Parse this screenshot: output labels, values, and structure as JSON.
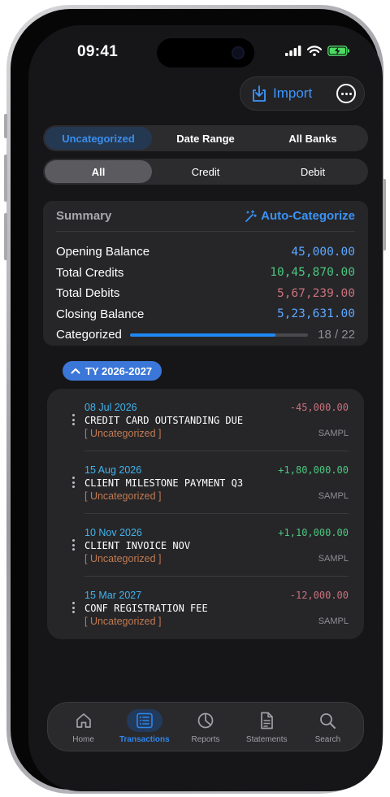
{
  "status_bar": {
    "time": "09:41"
  },
  "top_actions": {
    "import_label": "Import"
  },
  "filter_tabs": [
    {
      "label": "Uncategorized",
      "active": true
    },
    {
      "label": "Date Range",
      "active": false
    },
    {
      "label": "All Banks",
      "active": false
    }
  ],
  "type_tabs": [
    {
      "label": "All",
      "active": true
    },
    {
      "label": "Credit",
      "active": false
    },
    {
      "label": "Debit",
      "active": false
    }
  ],
  "summary": {
    "title": "Summary",
    "auto_categorize_label": "Auto-Categorize",
    "rows": [
      {
        "label": "Opening Balance",
        "value": "45,000.00",
        "color": "#5ca8ff"
      },
      {
        "label": "Total Credits",
        "value": "10,45,870.00",
        "color": "#4cc67d"
      },
      {
        "label": "Total Debits",
        "value": "5,67,239.00",
        "color": "#c9717b"
      },
      {
        "label": "Closing Balance",
        "value": "5,23,631.00",
        "color": "#5ca8ff"
      }
    ],
    "categorized_label": "Categorized",
    "categorized_count": "18 / 22",
    "categorized_fraction": 0.818
  },
  "year_group": {
    "label": "TY 2026-2027",
    "expanded": true
  },
  "transactions": [
    {
      "date": "08 Jul 2026",
      "description": "CREDIT CARD OUTSTANDING DUE",
      "category": "[ Uncategorized ]",
      "amount": "-45,000.00",
      "source": "SAMPL"
    },
    {
      "date": "15 Aug 2026",
      "description": "CLIENT MILESTONE PAYMENT Q3",
      "category": "[ Uncategorized ]",
      "amount": "+1,80,000.00",
      "source": "SAMPL"
    },
    {
      "date": "10 Nov 2026",
      "description": "CLIENT INVOICE NOV",
      "category": "[ Uncategorized ]",
      "amount": "+1,10,000.00",
      "source": "SAMPL"
    },
    {
      "date": "15 Mar 2027",
      "description": "CONF REGISTRATION FEE",
      "category": "[ Uncategorized ]",
      "amount": "-12,000.00",
      "source": "SAMPL"
    }
  ],
  "colors": {
    "credit": "#4cc67d",
    "debit": "#c9717b",
    "accent": "#2f86ea"
  },
  "tab_bar": [
    {
      "label": "Home",
      "icon": "house-icon",
      "active": false
    },
    {
      "label": "Transactions",
      "icon": "list-icon",
      "active": true
    },
    {
      "label": "Reports",
      "icon": "pie-chart-icon",
      "active": false
    },
    {
      "label": "Statements",
      "icon": "document-icon",
      "active": false
    },
    {
      "label": "Search",
      "icon": "magnifier-icon",
      "active": false
    }
  ]
}
